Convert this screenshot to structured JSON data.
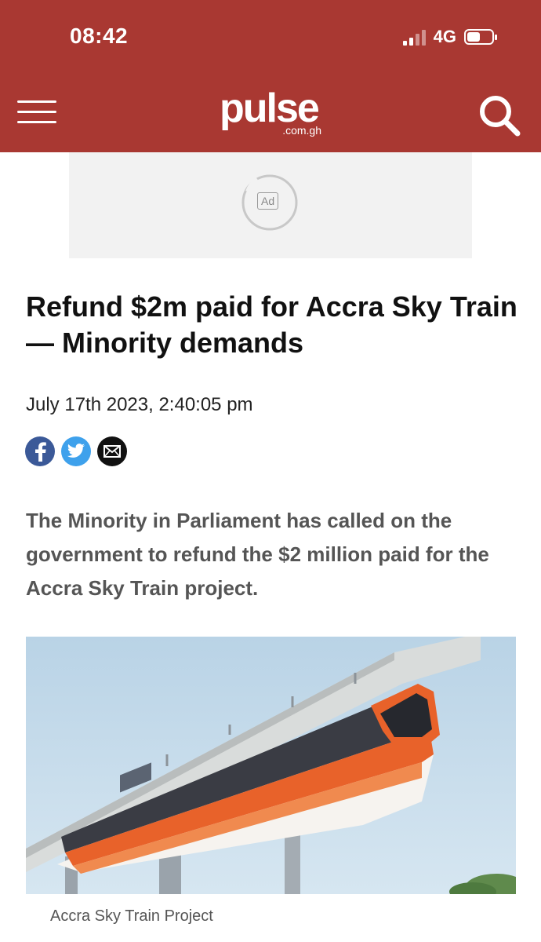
{
  "status_bar": {
    "time": "08:42",
    "network": "4G",
    "battery_level": 0.6
  },
  "header": {
    "logo_text": "pulse",
    "logo_domain": ".com.gh",
    "menu_icon": "hamburger-menu-icon",
    "search_icon": "search-icon",
    "background_color": "#a93832"
  },
  "ad": {
    "label": "Ad"
  },
  "article": {
    "title": "Refund $2m paid for Accra Sky Train — Minority demands",
    "date": "July 17th 2023, 2:40:05 pm",
    "share": [
      {
        "icon": "facebook-icon",
        "color": "#3b5998"
      },
      {
        "icon": "twitter-icon",
        "color": "#3ea1ec"
      },
      {
        "icon": "email-icon",
        "color": "#111111"
      }
    ],
    "lead": "The Minority in Parliament has called on the government to refund the $2 million paid for the Accra Sky Train project.",
    "image_caption": "Accra Sky Train Project"
  }
}
